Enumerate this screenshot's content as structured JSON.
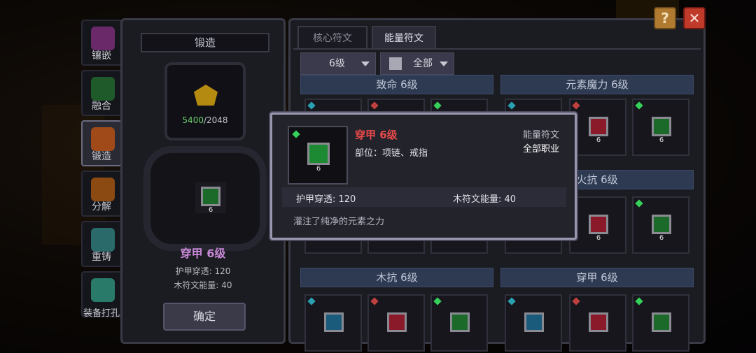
{
  "colors": {
    "accent_red": "#e84a4a",
    "rune_green": "#1b6a2a",
    "rune_red": "#8a1a2a",
    "rune_blue": "#1a5a7a",
    "name_purple": "#c98ad8"
  },
  "sidenav": {
    "items": [
      {
        "label": "镶嵌",
        "icon": "inlay-icon"
      },
      {
        "label": "融合",
        "icon": "fusion-icon"
      },
      {
        "label": "锻造",
        "icon": "forge-icon"
      },
      {
        "label": "分解",
        "icon": "decompose-icon"
      },
      {
        "label": "重铸",
        "icon": "recast-icon"
      },
      {
        "label": "装备打孔",
        "icon": "punch-icon"
      }
    ]
  },
  "forge": {
    "title": "锻造",
    "have": "5400",
    "need": "/2048",
    "rune_level": "6",
    "item_name": "穿甲 6级",
    "stat1": "护甲穿透: 120",
    "stat2": "木符文能量: 40",
    "confirm": "确定"
  },
  "tabs": {
    "core": "核心符文",
    "energy": "能量符文"
  },
  "filters": {
    "level": "6级",
    "category": "全部"
  },
  "groups": {
    "g1": "致命 6级",
    "g2": "元素魔力 6级",
    "g3": "火抗 6级",
    "g4": "木抗 6级",
    "g5": "穿甲 6级"
  },
  "card_level": "6",
  "tooltip": {
    "name": "穿甲 6级",
    "slot": "部位：项链、戒指",
    "type": "能量符文",
    "class": "全部职业",
    "stat1": "护甲穿透: 120",
    "stat2": "木符文能量: 40",
    "desc": "灌注了纯净的元素之力",
    "level": "6"
  },
  "buttons": {
    "help": "?",
    "close": "✕"
  }
}
